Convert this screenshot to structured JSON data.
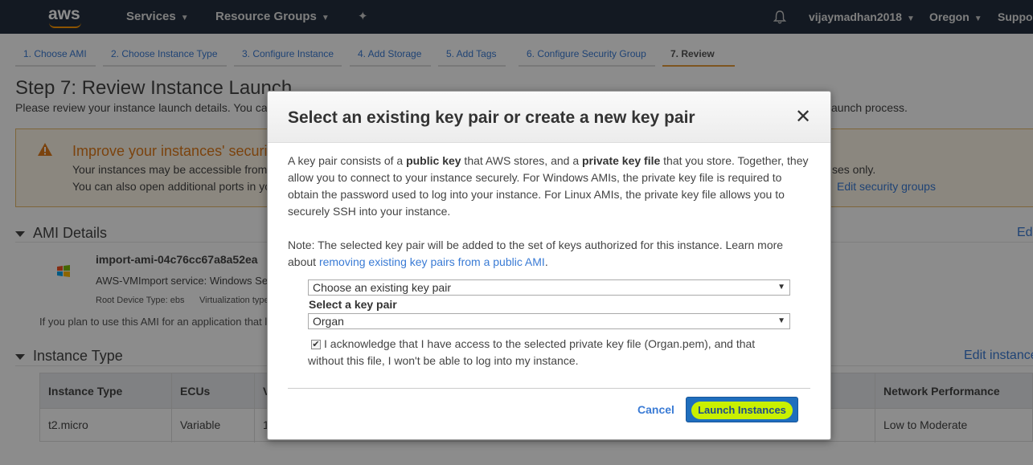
{
  "topnav": {
    "logo": "aws",
    "services": "Services",
    "resource_groups": "Resource Groups",
    "user": "vijaymadhan2018",
    "region": "Oregon",
    "support": "Support",
    "pin_icon": "pin-icon",
    "bell_icon": "bell-icon"
  },
  "tabs": [
    {
      "label": "1. Choose AMI"
    },
    {
      "label": "2. Choose Instance Type"
    },
    {
      "label": "3. Configure Instance"
    },
    {
      "label": "4. Add Storage"
    },
    {
      "label": "5. Add Tags"
    },
    {
      "label": "6. Configure Security Group"
    },
    {
      "label": "7. Review"
    }
  ],
  "page": {
    "title": "Step 7: Review Instance Launch",
    "subtitle_left": "Please review your instance launch details. You ca",
    "subtitle_right": "aunch process.",
    "warning": {
      "title": "Improve your instances' securi",
      "line1": "Your instances may be accessible from",
      "line2": "You can also open additional ports in yo",
      "line1_right": "ses only.",
      "link": "Edit security groups"
    },
    "ami_section": {
      "title": "AMI Details",
      "edit": "Ed",
      "name": "import-ami-04c76cc67a8a52ea",
      "desc": "AWS-VMImport service: Windows Se",
      "meta_root": "Root Device Type: ebs",
      "meta_virt": "Virtualization type",
      "note": "If you plan to use this AMI for an application that l"
    },
    "instance_section": {
      "title": "Instance Type",
      "edit": "Edit instance",
      "headers": [
        "Instance Type",
        "ECUs",
        "V",
        "Network Performance"
      ],
      "row": [
        "t2.micro",
        "Variable",
        "1",
        "Low to Moderate"
      ]
    }
  },
  "modal": {
    "title": "Select an existing key pair or create a new key pair",
    "close": "✕",
    "p1": {
      "l1_a": "A key pair consists of a ",
      "l1_b": "public key",
      "l1_c": " that AWS stores, and a ",
      "l1_d": "private key file",
      "l1_e": " that you store. Together, they",
      "l2": "allow you to connect to your instance securely. For Windows AMIs, the private key file is required to",
      "l3": "obtain the password used to log into your instance. For Linux AMIs, the private key file allows you to",
      "l4": "securely SSH into your instance."
    },
    "p2": {
      "l1": "Note: The selected key pair will be added to the set of keys authorized for this instance. Learn more",
      "l2_a": "about ",
      "l2_link": "removing existing key pairs from a public AMI",
      "l2_b": "."
    },
    "select_mode": "Choose an existing key pair",
    "select_label": "Select a key pair",
    "select_key": "Organ",
    "ack_l1": "I acknowledge that I have access to the selected private key file (Organ.pem), and that",
    "ack_l2": "without this file, I won't be able to log into my instance.",
    "cancel": "Cancel",
    "launch": "Launch Instances"
  }
}
